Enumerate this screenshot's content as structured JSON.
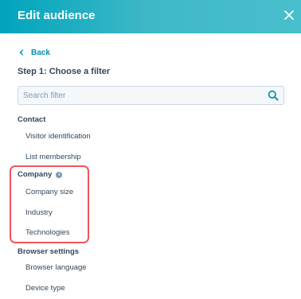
{
  "header": {
    "title": "Edit audience"
  },
  "nav": {
    "back_label": "Back"
  },
  "step": {
    "title": "Step 1: Choose a filter"
  },
  "search": {
    "placeholder": "Search filter",
    "value": ""
  },
  "groups": [
    {
      "title": "Contact",
      "items": [
        "Visitor identification",
        "List membership"
      ]
    },
    {
      "title": "Company",
      "has_info_icon": true,
      "items": [
        "Company size",
        "Industry",
        "Technologies"
      ]
    },
    {
      "title": "Browser settings",
      "items": [
        "Browser language",
        "Device type"
      ]
    }
  ],
  "colors": {
    "header_gradient_start": "#00a4bd",
    "header_gradient_end": "#48bfcc",
    "link": "#0091ae",
    "text": "#33475b",
    "highlight": "#f2545b"
  }
}
